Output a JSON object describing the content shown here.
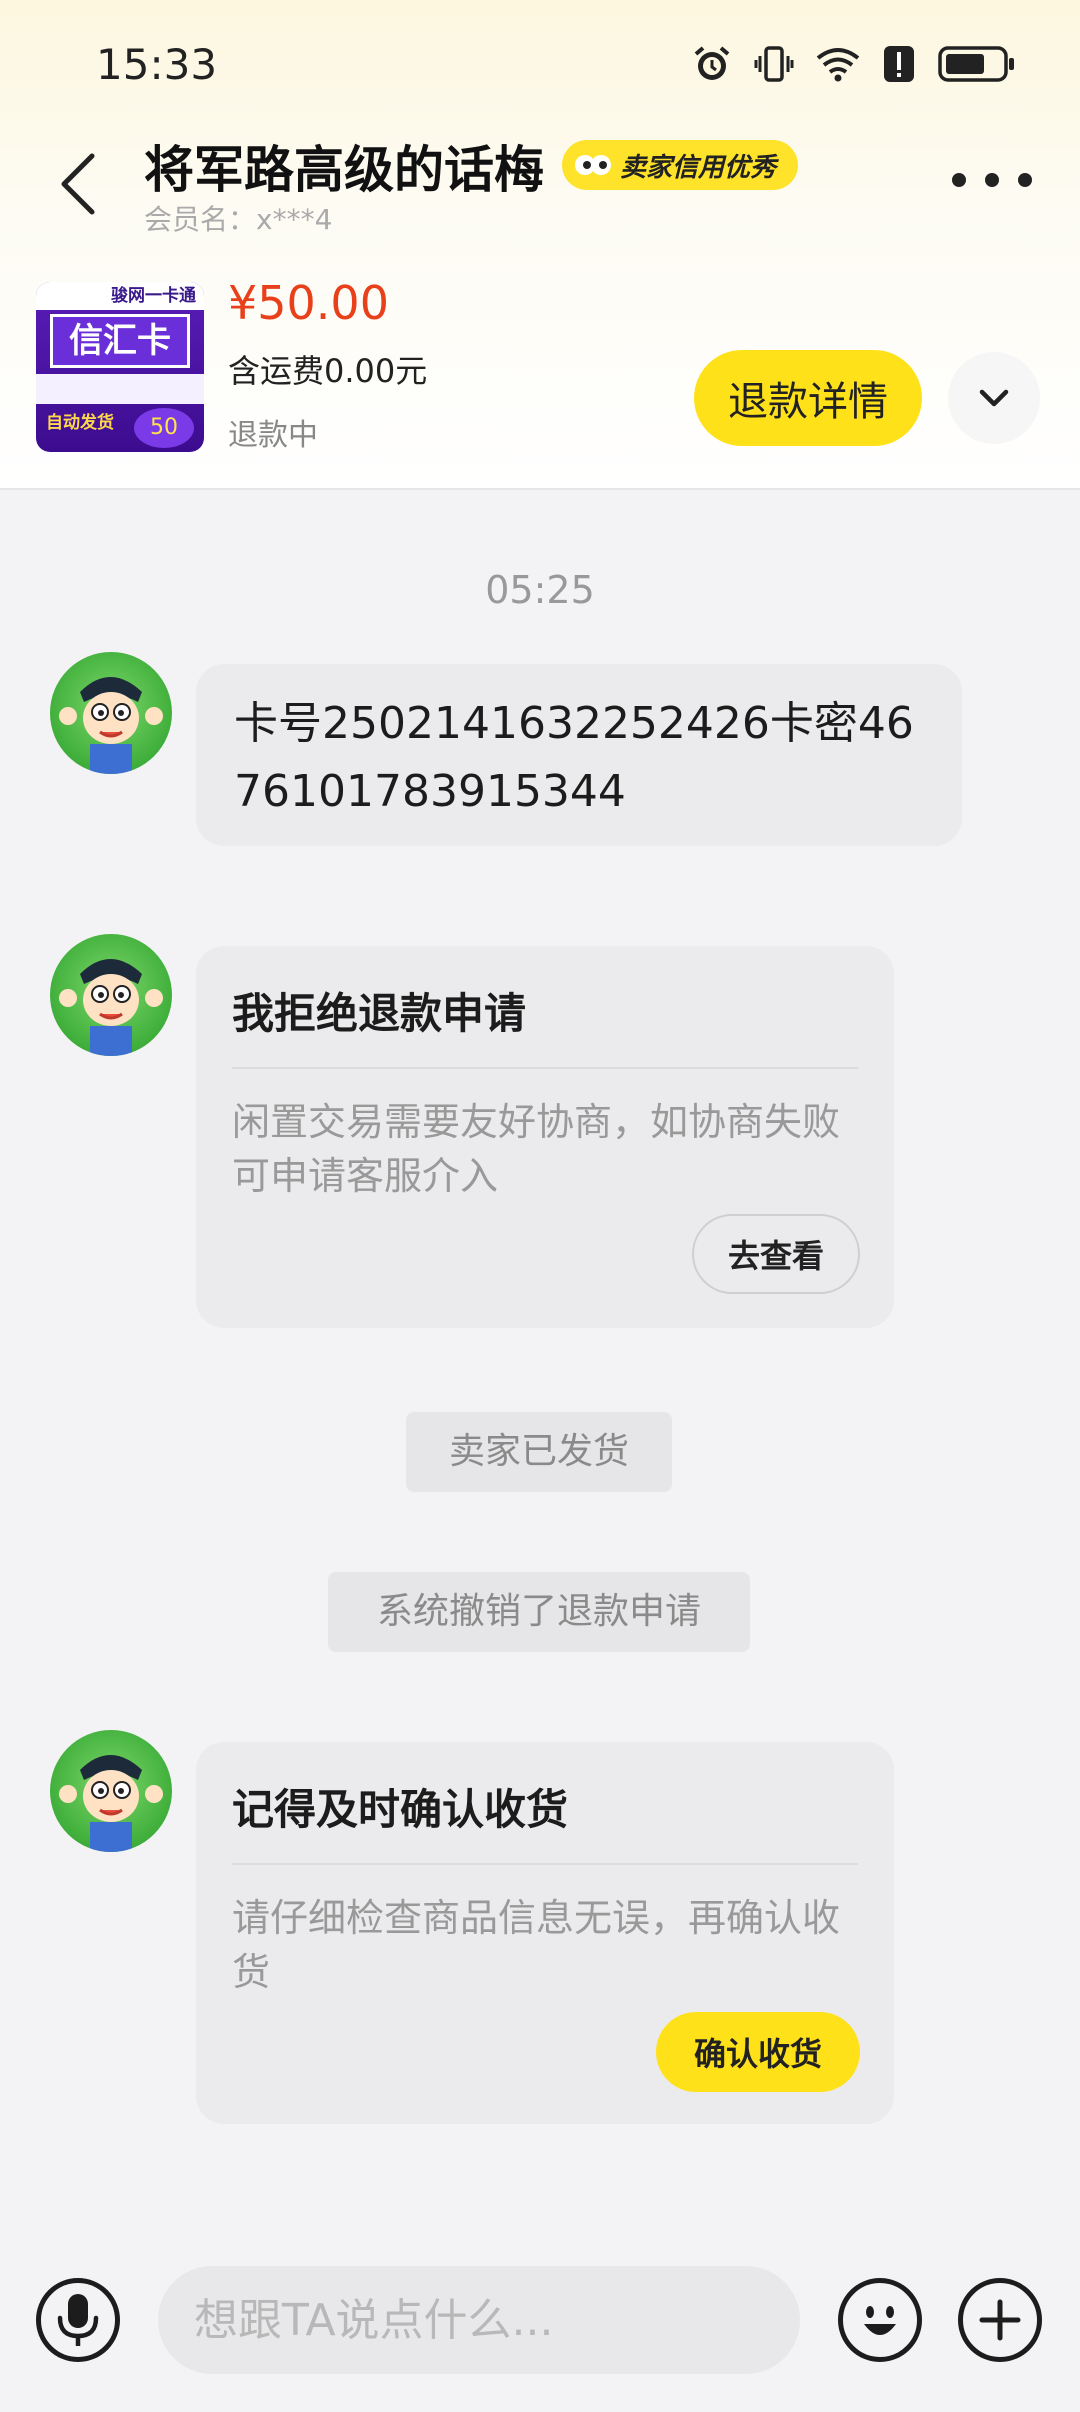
{
  "status_bar": {
    "time": "15:33"
  },
  "header": {
    "seller_name": "将军路高级的话梅",
    "credit_badge": "卖家信用优秀",
    "member_label": "会员名：x***4"
  },
  "product": {
    "thumb_top": "骏网一卡通",
    "thumb_title": "信汇卡",
    "thumb_auto": "自动发货",
    "thumb_amount": "50",
    "price": "¥50.00",
    "shipping": "含运费0.00元",
    "status": "退款中",
    "refund_button": "退款详情"
  },
  "chat": {
    "time_1": "05:25",
    "msg_1": "卡号2502141632252426卡密4676101783915344",
    "card_1": {
      "title": "我拒绝退款申请",
      "desc": "闲置交易需要友好协商，如协商失败可申请客服介入",
      "button": "去查看"
    },
    "system_1": "卖家已发货",
    "system_2": "系统撤销了退款申请",
    "card_2": {
      "title": "记得及时确认收货",
      "desc": "请仔细检查商品信息无误，再确认收货",
      "button": "确认收货"
    }
  },
  "input": {
    "placeholder": "想跟TA说点什么..."
  },
  "colors": {
    "accent_yellow": "#ffe11a",
    "price_red": "#e8401a",
    "background": "#f3f3f5"
  }
}
